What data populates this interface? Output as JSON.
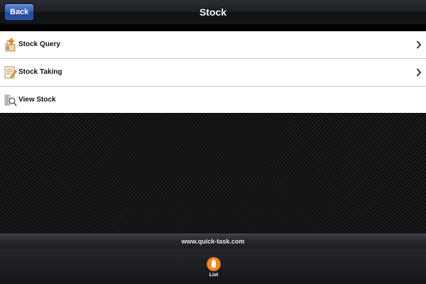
{
  "navbar": {
    "back_label": "Back",
    "title": "Stock"
  },
  "menu": {
    "items": [
      {
        "label": "Stock Query",
        "icon": "stock-query-icon",
        "has_chevron": true
      },
      {
        "label": "Stock Taking",
        "icon": "stock-taking-icon",
        "has_chevron": true
      },
      {
        "label": "View Stock",
        "icon": "view-stock-icon",
        "has_chevron": false
      }
    ]
  },
  "footer": {
    "url": "www.quick-task.com"
  },
  "tabbar": {
    "tabs": [
      {
        "label": "List",
        "icon": "list-icon",
        "accent": "#f08a24"
      }
    ]
  },
  "colors": {
    "back_button": "#335fb3",
    "tab_accent": "#f08a24"
  }
}
